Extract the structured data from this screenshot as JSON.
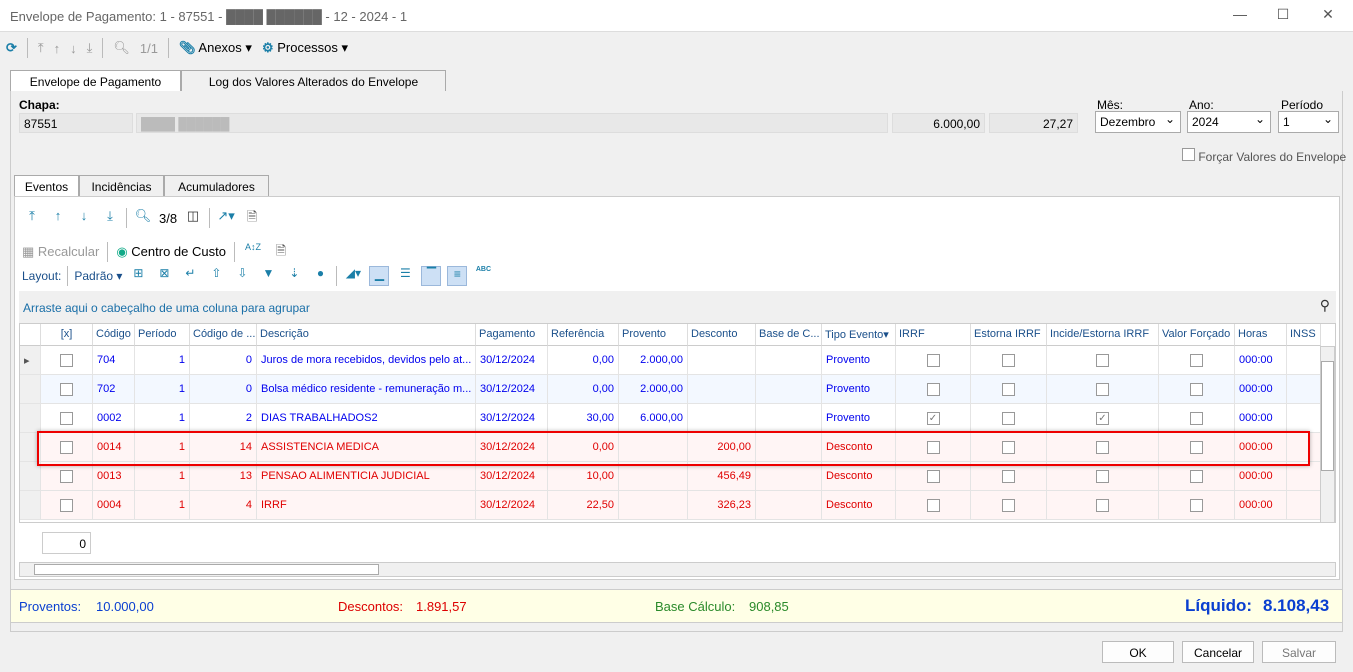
{
  "window": {
    "title": "Envelope de Pagamento: 1 - 87551 - ████ ██████ - 12 - 2024 - 1"
  },
  "toolbar": {
    "record": "1/1",
    "anexos": "Anexos",
    "processos": "Processos"
  },
  "tabs": [
    "Envelope de Pagamento",
    "Log dos Valores Alterados do Envelope"
  ],
  "header": {
    "chapa_label": "Chapa:",
    "chapa": "87551",
    "nome": "████ ██████",
    "valor1": "6.000,00",
    "valor2": "27,27",
    "mes_label": "Mês:",
    "mes": "Dezembro",
    "ano_label": "Ano:",
    "ano": "2024",
    "periodo_label": "Período",
    "periodo": "1",
    "forcar_label": "Forçar Valores do Envelope"
  },
  "subtabs": [
    "Eventos",
    "Incidências",
    "Acumuladores"
  ],
  "grid_toolbar": {
    "record": "3/8",
    "recalcular": "Recalcular",
    "centro_custo": "Centro de Custo",
    "layout_label": "Layout:",
    "layout": "Padrão",
    "group_hint": "Arraste aqui o cabeçalho de uma coluna para agrupar"
  },
  "columns": [
    "[x]",
    "Código",
    "Período",
    "Código de ...",
    "Descrição",
    "Pagamento",
    "Referência",
    "Provento",
    "Desconto",
    "Base de C...",
    "Tipo Evento",
    "IRRF",
    "Estorna IRRF",
    "Incide/Estorna IRRF",
    "Valor Forçado",
    "Horas",
    "INSS"
  ],
  "rows": [
    {
      "codigo": "704",
      "periodo": "1",
      "cod": "0",
      "descricao": "Juros de mora recebidos, devidos pelo at...",
      "pagamento": "30/12/2024",
      "referencia": "0,00",
      "provento": "2.000,00",
      "desconto": "",
      "tipo": "Provento",
      "irrf": false,
      "estorna": false,
      "incide": false,
      "forcado": false,
      "horas": "000:00"
    },
    {
      "codigo": "702",
      "periodo": "1",
      "cod": "0",
      "descricao": "Bolsa médico residente - remuneração m...",
      "pagamento": "30/12/2024",
      "referencia": "0,00",
      "provento": "2.000,00",
      "desconto": "",
      "tipo": "Provento",
      "irrf": false,
      "estorna": false,
      "incide": false,
      "forcado": false,
      "horas": "000:00"
    },
    {
      "codigo": "0002",
      "periodo": "1",
      "cod": "2",
      "descricao": "DIAS TRABALHADOS2",
      "pagamento": "30/12/2024",
      "referencia": "30,00",
      "provento": "6.000,00",
      "desconto": "",
      "tipo": "Provento",
      "irrf": true,
      "estorna": false,
      "incide": true,
      "forcado": false,
      "horas": "000:00"
    },
    {
      "codigo": "0014",
      "periodo": "1",
      "cod": "14",
      "descricao": "ASSISTENCIA MEDICA",
      "pagamento": "30/12/2024",
      "referencia": "0,00",
      "provento": "",
      "desconto": "200,00",
      "tipo": "Desconto",
      "irrf": false,
      "estorna": false,
      "incide": false,
      "forcado": false,
      "horas": "000:00",
      "highlighted": true
    },
    {
      "codigo": "0013",
      "periodo": "1",
      "cod": "13",
      "descricao": "PENSAO ALIMENTICIA JUDICIAL",
      "pagamento": "30/12/2024",
      "referencia": "10,00",
      "provento": "",
      "desconto": "456,49",
      "tipo": "Desconto",
      "irrf": false,
      "estorna": false,
      "incide": false,
      "forcado": false,
      "horas": "000:00"
    },
    {
      "codigo": "0004",
      "periodo": "1",
      "cod": "4",
      "descricao": "IRRF",
      "pagamento": "30/12/2024",
      "referencia": "22,50",
      "provento": "",
      "desconto": "326,23",
      "tipo": "Desconto",
      "irrf": false,
      "estorna": false,
      "incide": false,
      "forcado": false,
      "horas": "000:00"
    }
  ],
  "footer_count": "0",
  "totals": {
    "proventos_label": "Proventos:",
    "proventos": "10.000,00",
    "descontos_label": "Descontos:",
    "descontos": "1.891,57",
    "base_label": "Base Cálculo:",
    "base": "908,85",
    "liquido_label": "Líquido:",
    "liquido": "8.108,43"
  },
  "buttons": {
    "ok": "OK",
    "cancelar": "Cancelar",
    "salvar": "Salvar"
  },
  "colors": {
    "provento": "#0000ee",
    "desconto": "#e00000",
    "highlight": "#e00000",
    "accent": "#1b7fa8"
  }
}
